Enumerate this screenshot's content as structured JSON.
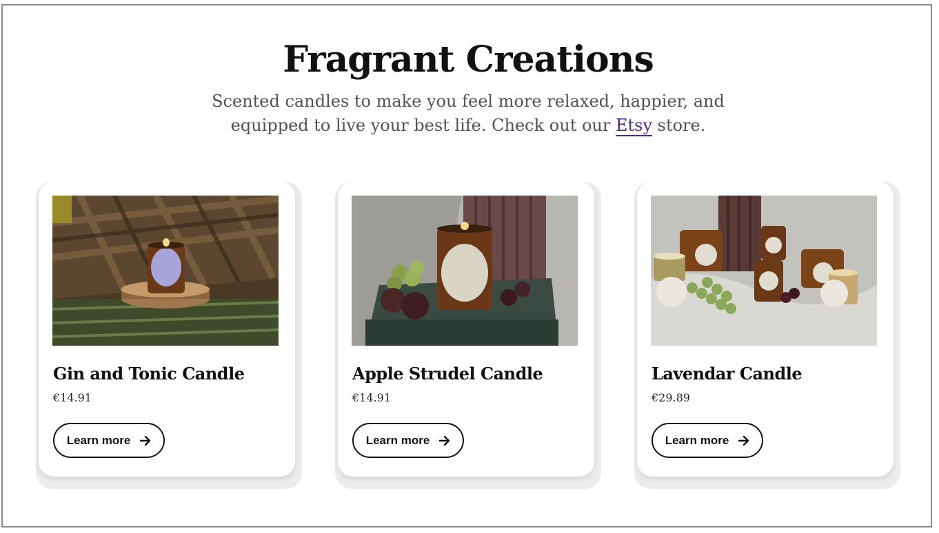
{
  "header": {
    "title": "Fragrant Creations",
    "subtitle_before": "Scented candles to make you feel more relaxed, happier, and equipped to live your best life. Check out our ",
    "subtitle_link": "Etsy",
    "subtitle_after": " store."
  },
  "products": [
    {
      "name": "Gin and Tonic Candle",
      "price": "€14.91",
      "button_label": "Learn more",
      "image_icon": "gin-tonic-candle-photo"
    },
    {
      "name": "Apple Strudel Candle",
      "price": "€14.91",
      "button_label": "Learn more",
      "image_icon": "apple-strudel-candle-photo"
    },
    {
      "name": "Lavendar Candle",
      "price": "€29.89",
      "button_label": "Learn more",
      "image_icon": "lavendar-candle-photo"
    }
  ],
  "colors": {
    "link": "#4b2a86",
    "text": "#111111",
    "subtitle": "#4d5355"
  }
}
